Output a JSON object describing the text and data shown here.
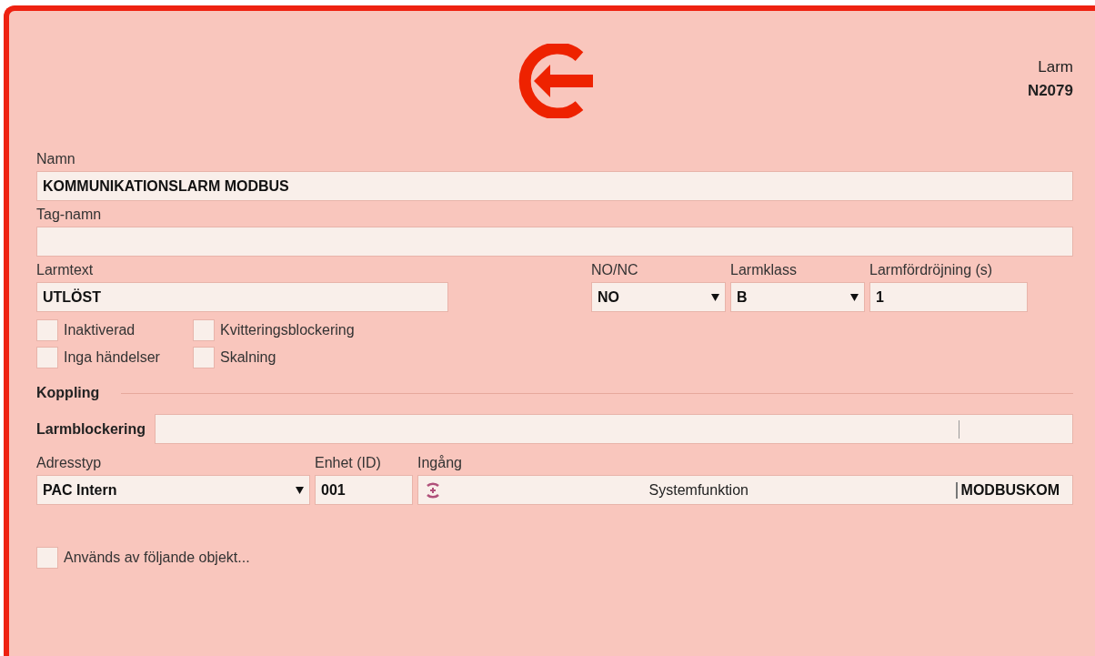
{
  "header": {
    "object_type": "Larm",
    "object_id": "N2079"
  },
  "name": {
    "label": "Namn",
    "value": "KOMMUNIKATIONSLARM MODBUS"
  },
  "tag_name": {
    "label": "Tag-namn"
  },
  "alarm_text": {
    "label": "Larmtext",
    "value": "UTLÖST"
  },
  "no_nc": {
    "label": "NO/NC",
    "value": "NO"
  },
  "alarm_class": {
    "label": "Larmklass",
    "value": "B"
  },
  "alarm_delay": {
    "label": "Larmfördröjning (s)",
    "value": "1"
  },
  "options": [
    {
      "label": "Inaktiverad",
      "checked": false
    },
    {
      "label": "Kvitteringsblockering",
      "checked": false
    },
    {
      "label": "Inga händelser",
      "checked": false
    },
    {
      "label": "Skalning",
      "checked": false
    }
  ],
  "section_title": "Koppling",
  "alarm_blocking": {
    "label": "Larmblockering"
  },
  "address_type": {
    "label": "Adresstyp",
    "value": "PAC Intern"
  },
  "unit_id": {
    "label": "Enhet (ID)",
    "value": "001"
  },
  "input": {
    "label": "Ingång",
    "function": "Systemfunktion",
    "value": "MODBUSKOM"
  },
  "used_by": {
    "label": "Används av följande objekt...",
    "checked": false
  }
}
